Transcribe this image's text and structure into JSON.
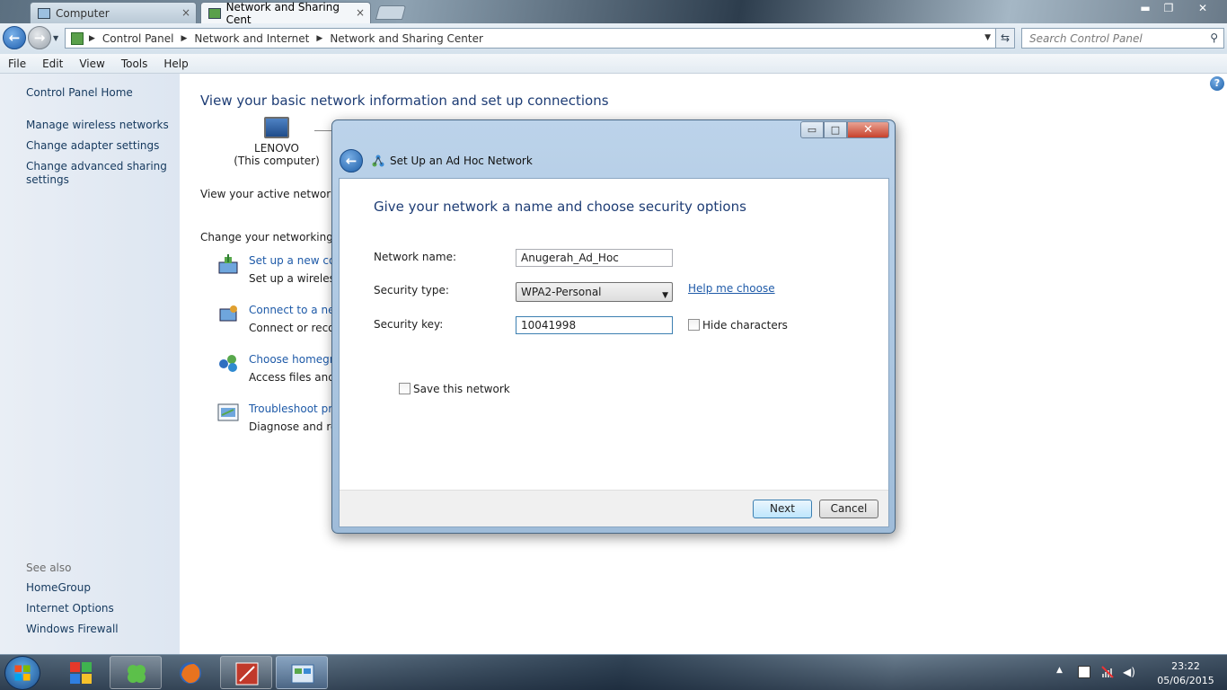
{
  "window": {
    "tabs": [
      {
        "label": "Computer"
      },
      {
        "label": "Network and Sharing Cent"
      }
    ],
    "close_glyph": "×",
    "controls": {
      "minimize": "▬",
      "restore": "❐",
      "close": "✕"
    }
  },
  "address": {
    "breadcrumbs": [
      "Control Panel",
      "Network and Internet",
      "Network and Sharing Center"
    ],
    "search_placeholder": "Search Control Panel"
  },
  "menu": {
    "items": [
      "File",
      "Edit",
      "View",
      "Tools",
      "Help"
    ]
  },
  "sidebar": {
    "home": "Control Panel Home",
    "links": [
      "Manage wireless networks",
      "Change adapter settings",
      "Change advanced sharing settings"
    ],
    "see_also": "See also",
    "see_also_links": [
      "HomeGroup",
      "Internet Options",
      "Windows Firewall"
    ]
  },
  "main": {
    "title": "View your basic network information and set up connections",
    "computer_name": "LENOVO",
    "computer_sub": "(This computer)",
    "active_networks": "View your active networks",
    "change_settings": "Change your networking se",
    "tasks": [
      {
        "link": "Set up a new conn",
        "desc": "Set up a wireless,"
      },
      {
        "link": "Connect to a netw",
        "desc": "Connect or recon"
      },
      {
        "link": "Choose homegro",
        "desc": "Access files and p"
      },
      {
        "link": "Troubleshoot pro",
        "desc": "Diagnose and rep"
      }
    ]
  },
  "dialog": {
    "title": "Set Up an Ad Hoc Network",
    "heading": "Give your network a name and choose security options",
    "network_name_label": "Network name:",
    "network_name_value": "Anugerah_Ad_Hoc",
    "security_type_label": "Security type:",
    "security_type_value": "WPA2-Personal",
    "help_link": "Help me choose",
    "security_key_label": "Security key:",
    "security_key_value": "10041998",
    "hide_characters": "Hide characters",
    "save_network": "Save this network",
    "next": "Next",
    "cancel": "Cancel"
  },
  "taskbar": {
    "time": "23:22",
    "date": "05/06/2015"
  }
}
